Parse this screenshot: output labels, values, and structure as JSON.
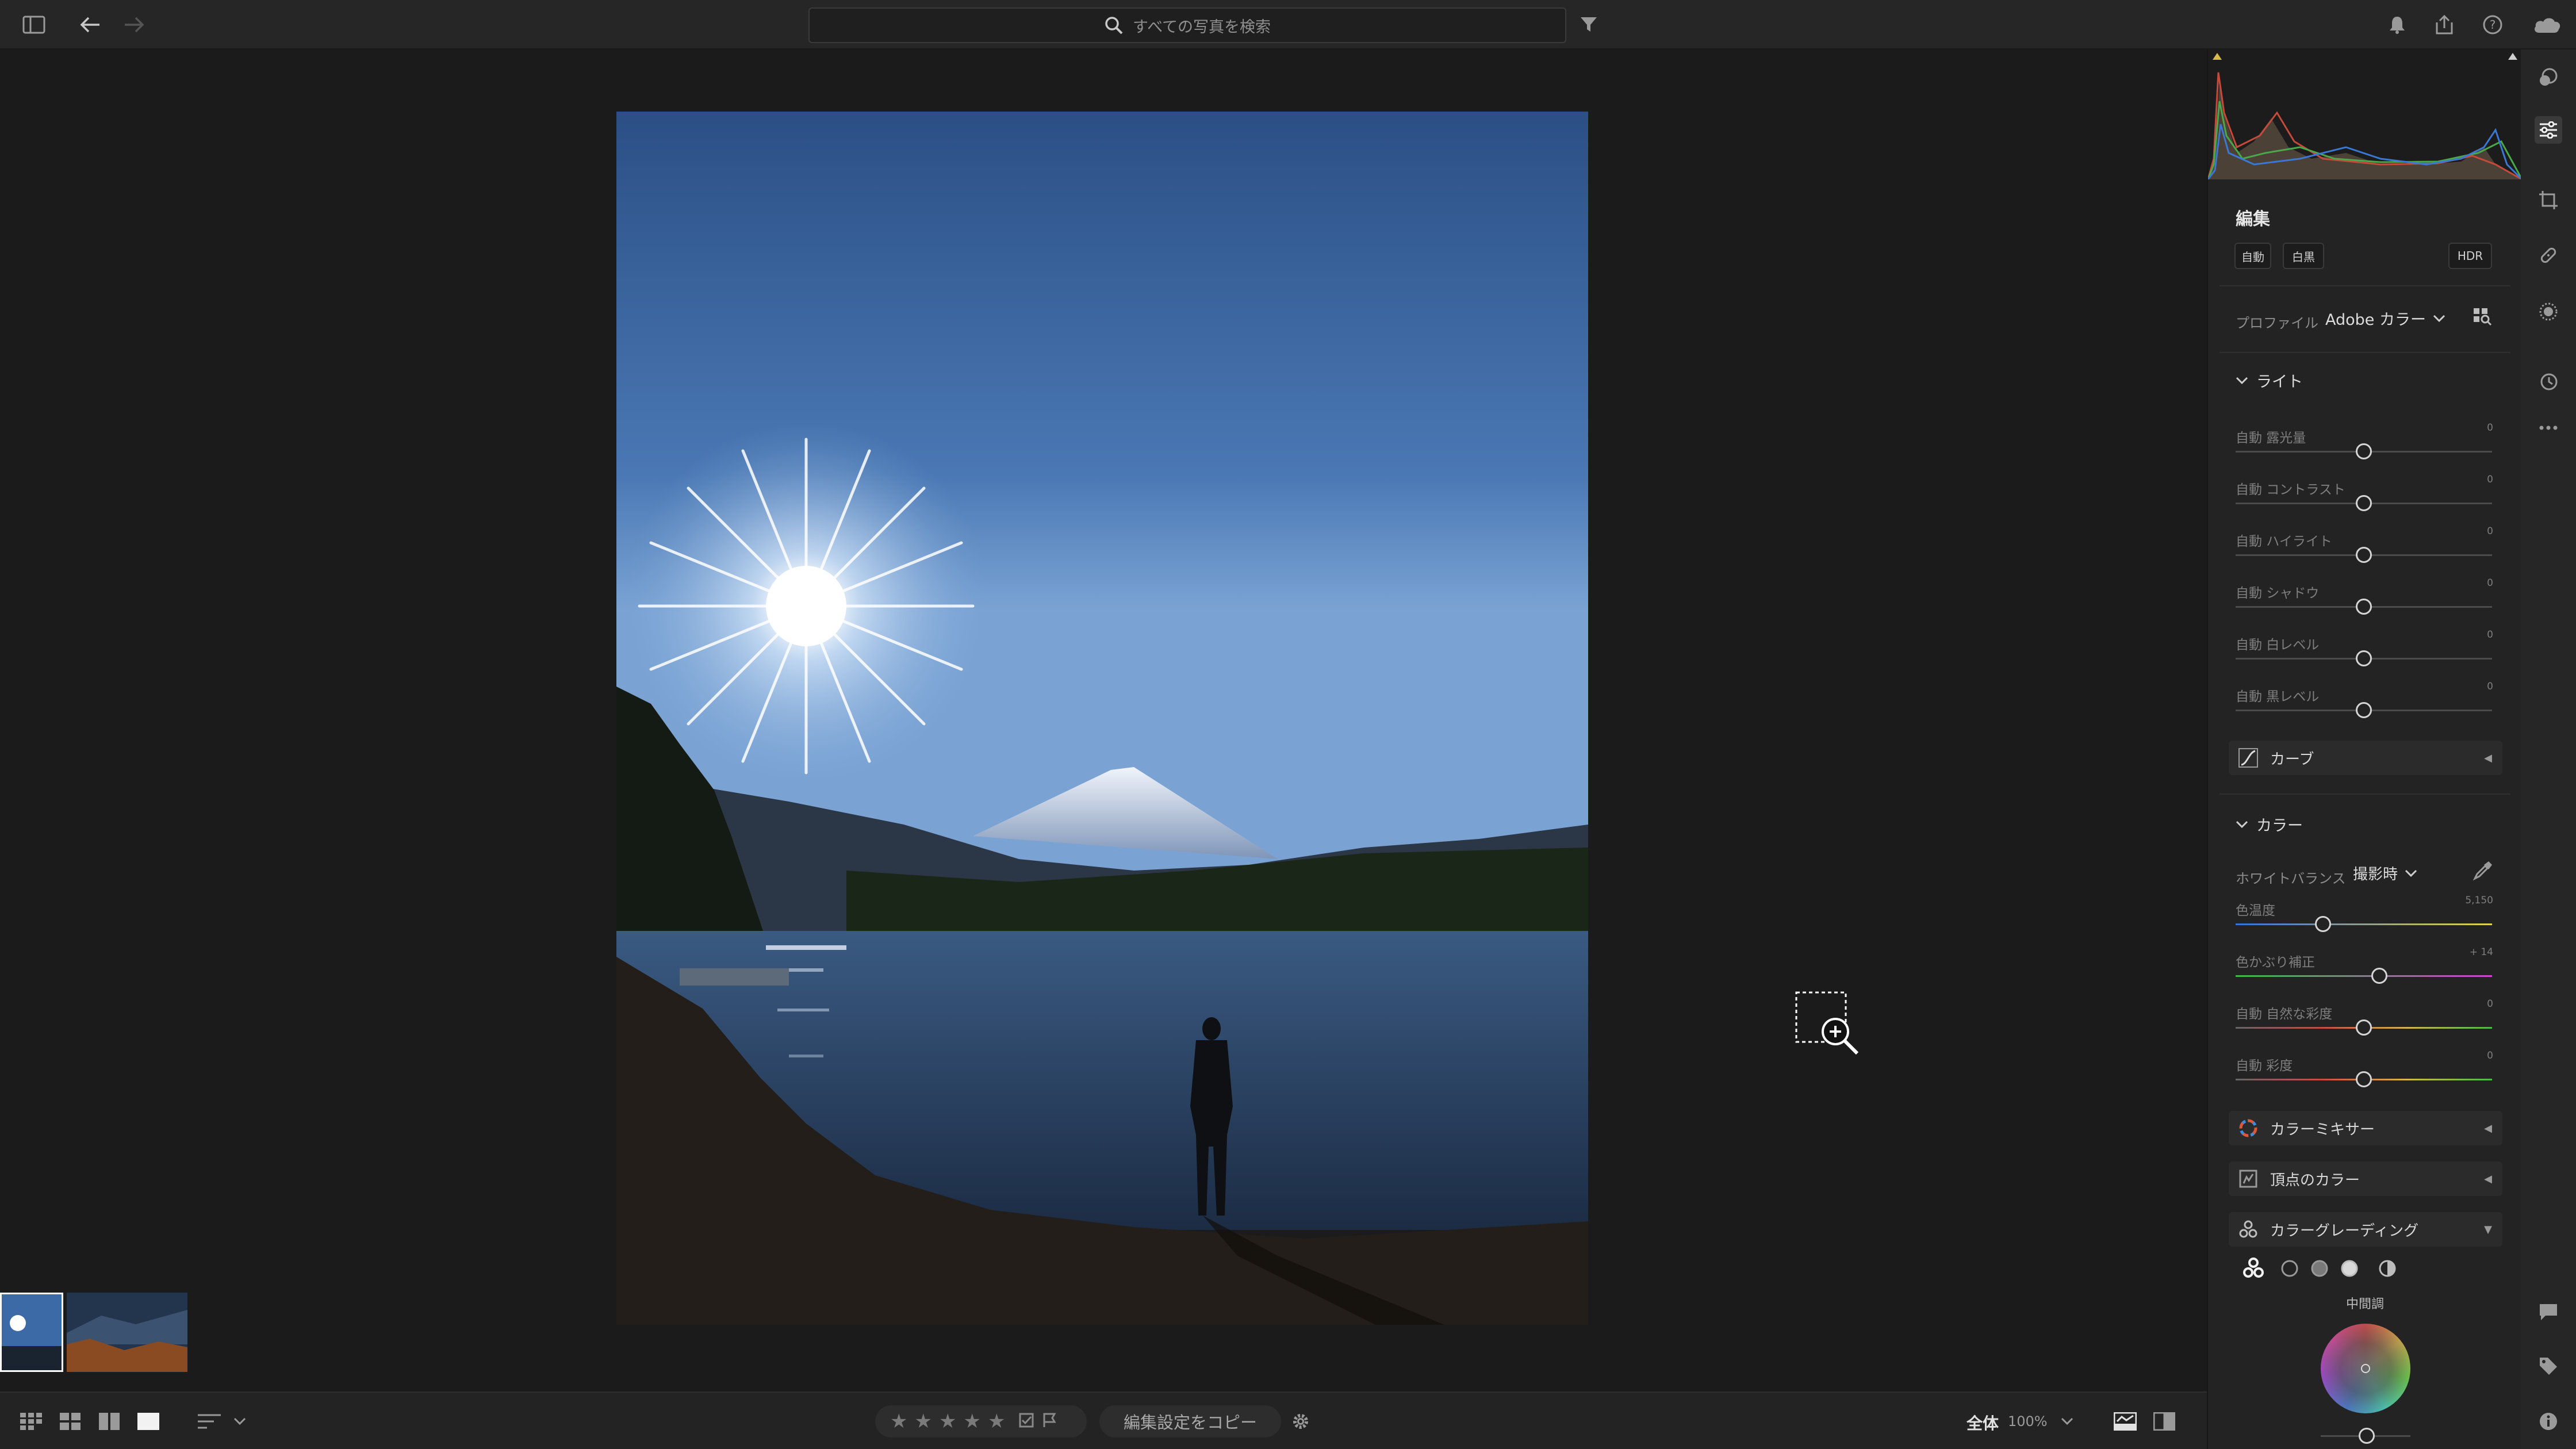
{
  "search": {
    "placeholder": "すべての写真を検索"
  },
  "edit_panel": {
    "title": "編集",
    "buttons": {
      "auto": "自動",
      "bw": "白黒",
      "hdr": "HDR"
    },
    "profile": {
      "label": "プロファイル",
      "value": "Adobe カラー"
    },
    "light": {
      "title": "ライト",
      "sliders": [
        {
          "label": "自動 露光量",
          "value": "0",
          "level": 0.5
        },
        {
          "label": "自動 コントラスト",
          "value": "0",
          "level": 0.5
        },
        {
          "label": "自動 ハイライト",
          "value": "0",
          "level": 0.5
        },
        {
          "label": "自動 シャドウ",
          "value": "0",
          "level": 0.5
        },
        {
          "label": "自動 白レベル",
          "value": "0",
          "level": 0.5
        },
        {
          "label": "自動 黒レベル",
          "value": "0",
          "level": 0.5
        }
      ]
    },
    "curve": {
      "label": "カーブ"
    },
    "color": {
      "title": "カラー",
      "wb_label": "ホワイトバランス",
      "wb_value": "撮影時",
      "sliders": [
        {
          "label": "色温度",
          "value": "5,150",
          "level": 0.34
        },
        {
          "label": "色かぶり補正",
          "value": "+ 14",
          "level": 0.56
        },
        {
          "label": "自動 自然な彩度",
          "value": "0",
          "level": 0.5
        },
        {
          "label": "自動 彩度",
          "value": "0",
          "level": 0.5
        }
      ]
    },
    "color_mixer": {
      "label": "カラーミキサー"
    },
    "point_color": {
      "label": "頂点のカラー"
    },
    "color_grading": {
      "label": "カラーグレーディング",
      "wheel_label": "中間調"
    }
  },
  "bottom": {
    "copy_settings": "編集設定をコピー",
    "view_mode": "全体",
    "zoom": "100%",
    "stars": [
      "★",
      "★",
      "★",
      "★",
      "★"
    ]
  },
  "icons": {
    "sidebar_toggle": "sidebar-toggle-icon",
    "back": "back-arrow-icon",
    "forward": "forward-arrow-icon",
    "search": "search-icon",
    "filter": "filter-icon",
    "bell": "bell-icon",
    "share": "share-icon",
    "help": "help-icon",
    "cloud": "cloud-icon"
  }
}
